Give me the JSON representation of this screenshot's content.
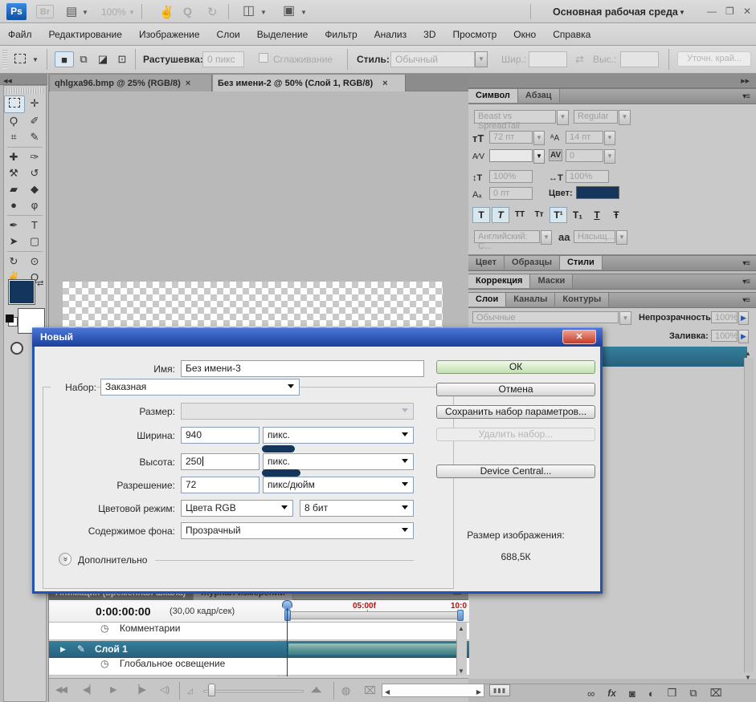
{
  "window": {
    "workspace": "Основная рабочая среда",
    "min": "—",
    "max": "❐",
    "close": "✕"
  },
  "appbar": {
    "ps": "Ps",
    "br": "Br",
    "zoom_level": "100%",
    "icons": {
      "bridge": "▤",
      "hand": "✌",
      "zoom_tool": "Q",
      "rotate": "↻",
      "arrange": "◫",
      "screen": "▣"
    }
  },
  "menu_items": [
    "Файл",
    "Редактирование",
    "Изображение",
    "Слои",
    "Выделение",
    "Фильтр",
    "Анализ",
    "3D",
    "Просмотр",
    "Окно",
    "Справка"
  ],
  "options": {
    "modes": [
      "■",
      "⧉",
      "◪",
      "⊡"
    ],
    "feather_label": "Растушевка:",
    "feather_value": "0 пикс",
    "smooth_label": "Сглаживание",
    "style_label": "Стиль:",
    "style_value": "Обычный",
    "w_label": "Шир.:",
    "swap": "⇄",
    "h_label": "Выс.:",
    "refine": "Уточн. край..."
  },
  "doc_tabs": [
    {
      "t": "qhlgxa96.bmp @ 25% (RGB/8)",
      "x": "×"
    },
    {
      "t": "Без имени-2 @ 50% (Слой 1, RGB/8)",
      "x": "×"
    }
  ],
  "toolbar": {
    "collapse": "◀◀",
    "swap": "⇄",
    "fg_color": "#14365c"
  },
  "tools": [
    {
      "n": "rectangular-marquee",
      "g": ""
    },
    {
      "n": "move",
      "g": "✛"
    },
    {
      "n": "lasso",
      "g": "Ϙ"
    },
    {
      "n": "quick-selection",
      "g": "✐"
    },
    {
      "n": "crop",
      "g": "⌗"
    },
    {
      "n": "eyedropper",
      "g": "✎"
    },
    {
      "n": "spot-healing-brush",
      "g": "✚"
    },
    {
      "n": "brush",
      "g": "✑"
    },
    {
      "n": "clone-stamp",
      "g": "⚒"
    },
    {
      "n": "history-brush",
      "g": "↺"
    },
    {
      "n": "eraser",
      "g": "▰"
    },
    {
      "n": "paint-bucket",
      "g": "◆"
    },
    {
      "n": "blur",
      "g": "●"
    },
    {
      "n": "dodge",
      "g": "φ"
    },
    {
      "n": "pen",
      "g": "✒"
    },
    {
      "n": "type",
      "g": "T"
    },
    {
      "n": "path-selection",
      "g": "➤"
    },
    {
      "n": "rounded-rectangle",
      "g": "▢"
    },
    {
      "n": "3d-rotate",
      "g": "↻"
    },
    {
      "n": "3d-orbit",
      "g": "⊙"
    },
    {
      "n": "hand",
      "g": "✌"
    },
    {
      "n": "zoom",
      "g": "Q"
    }
  ],
  "char": {
    "tab1": "Символ",
    "tab2": "Абзац",
    "font": "Beast vs SpreadTall",
    "style": "Regular",
    "size_icon": "тT",
    "size": "72 пт",
    "lead_icon": "ᴬA",
    "leading": "14 пт",
    "kern_icon": "A⁄V",
    "kern": "",
    "track_icon": "AV",
    "tracking": "0",
    "vscale_icon": "↕T",
    "vscale": "100%",
    "hscale_icon": "↔T",
    "hscale": "100%",
    "baseline_icon": "Aₐ",
    "baseline": "0 пт",
    "color_label": "Цвет:",
    "styles": [
      "T",
      "T",
      "TT",
      "Tᴛ",
      "T¹",
      "T₁",
      "T",
      "Ŧ"
    ],
    "lang": "Английский: С...",
    "aa_icon": "аa",
    "aa_value": "Насыщ..."
  },
  "panel_tabs": {
    "color": [
      "Цвет",
      "Образцы",
      "Стили"
    ],
    "adj": [
      "Коррекция",
      "Маски"
    ],
    "layers": [
      "Слои",
      "Каналы",
      "Контуры"
    ]
  },
  "layers": {
    "blend": "Обычные",
    "opacity_label": "Непрозрачность:",
    "opacity": "100%",
    "fill_label": "Заливка:",
    "fill": "100%",
    "bottom_icons": [
      {
        "n": "link-layers",
        "g": "∞"
      },
      {
        "n": "layer-styles",
        "g": "fx"
      },
      {
        "n": "layer-mask",
        "g": "◙"
      },
      {
        "n": "adjustment-layer",
        "g": "◐"
      },
      {
        "n": "layer-group",
        "g": "❒"
      },
      {
        "n": "new-layer",
        "g": "⧉"
      },
      {
        "n": "delete-layer",
        "g": "⌧"
      }
    ]
  },
  "dialog": {
    "title": "Новый",
    "close": "✕",
    "name_label": "Имя:",
    "name": "Без имени-3",
    "preset_label": "Набор:",
    "preset": "Заказная",
    "size_label": "Размер:",
    "width_label": "Ширина:",
    "width": "940",
    "width_unit": "пикс.",
    "height_label": "Высота:",
    "height": "250",
    "height_unit": "пикс.",
    "res_label": "Разрешение:",
    "res": "72",
    "res_unit": "пикс/дюйм",
    "mode_label": "Цветовой режим:",
    "mode": "Цвета RGB",
    "depth": "8 бит",
    "bg_label": "Содержимое фона:",
    "bg": "Прозрачный",
    "adv_label": "Дополнительно",
    "adv_icon": "»",
    "ok": "ОК",
    "cancel": "Отмена",
    "save": "Сохранить набор параметров...",
    "del": "Удалить набор...",
    "device": "Device Central...",
    "img_label": "Размер изображения:",
    "img_value": "688,5К"
  },
  "timeline": {
    "tab1": "Анимация (временная шкала)",
    "tab2": "Журнал измерений",
    "time": "0:00:00:00",
    "fps": "(30,00 кадр/сек)",
    "ruler_mid": "05:00f",
    "ruler_end": "10:0",
    "row_comments": "Комментарии",
    "row_layer": "Слой 1",
    "row_global": "Глобальное освещение",
    "stopwatch": "◷",
    "brush": "✎",
    "expander": "▶",
    "controls": [
      {
        "n": "rewind",
        "g": "◀◀"
      },
      {
        "n": "prev-frame",
        "g": "◀▏"
      },
      {
        "n": "play",
        "g": "▶"
      },
      {
        "n": "next-frame",
        "g": "▕▶"
      },
      {
        "n": "audio-toggle",
        "g": "◁)"
      },
      {
        "n": "zoom-out",
        "g": "◿"
      },
      {
        "n": "zoom-in",
        "g": "◢◣"
      },
      {
        "n": "onion-skin",
        "g": "◍"
      },
      {
        "n": "delete-frame",
        "g": "⌧"
      }
    ]
  }
}
